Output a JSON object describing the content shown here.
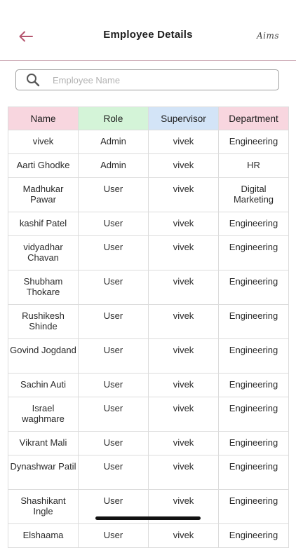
{
  "header": {
    "title": "Employee Details",
    "logo_text": "Aims"
  },
  "search": {
    "placeholder": "Employee Name",
    "value": ""
  },
  "table": {
    "columns": [
      "Name",
      "Role",
      "Supervisor",
      "Department"
    ],
    "header_colors": [
      "#f8d6df",
      "#d4f4d8",
      "#d3e4f7",
      "#f8d6df"
    ],
    "rows": [
      {
        "name": "vivek",
        "role": "Admin",
        "supervisor": "vivek",
        "department": "Engineering"
      },
      {
        "name": "Aarti Ghodke",
        "role": "Admin",
        "supervisor": "vivek",
        "department": "HR"
      },
      {
        "name": "Madhukar Pawar",
        "role": "User",
        "supervisor": "vivek",
        "department": "Digital Marketing"
      },
      {
        "name": "kashif Patel",
        "role": "User",
        "supervisor": "vivek",
        "department": "Engineering"
      },
      {
        "name": "vidyadhar Chavan",
        "role": "User",
        "supervisor": "vivek",
        "department": "Engineering"
      },
      {
        "name": "Shubham Thokare",
        "role": "User",
        "supervisor": "vivek",
        "department": "Engineering"
      },
      {
        "name": "Rushikesh Shinde",
        "role": "User",
        "supervisor": "vivek",
        "department": "Engineering"
      },
      {
        "name": "Govind Jogdand",
        "role": "User",
        "supervisor": "vivek",
        "department": "Engineering"
      },
      {
        "name": "Sachin Auti",
        "role": "User",
        "supervisor": "vivek",
        "department": "Engineering"
      },
      {
        "name": "Israel waghmare",
        "role": "User",
        "supervisor": "vivek",
        "department": "Engineering"
      },
      {
        "name": "Vikrant Mali",
        "role": "User",
        "supervisor": "vivek",
        "department": "Engineering"
      },
      {
        "name": "Dynashwar Patil",
        "role": "User",
        "supervisor": "vivek",
        "department": "Engineering"
      },
      {
        "name": "Shashikant Ingle",
        "role": "User",
        "supervisor": "vivek",
        "department": "Engineering"
      },
      {
        "name": "Elshaama",
        "role": "User",
        "supervisor": "vivek",
        "department": "Engineering"
      }
    ]
  },
  "colors": {
    "accent": "#b5566f",
    "header_divider": "#caa6b2",
    "grid": "#dcdcdc"
  },
  "icons": {
    "back": "arrow-left-icon",
    "search": "magnifier-icon"
  }
}
